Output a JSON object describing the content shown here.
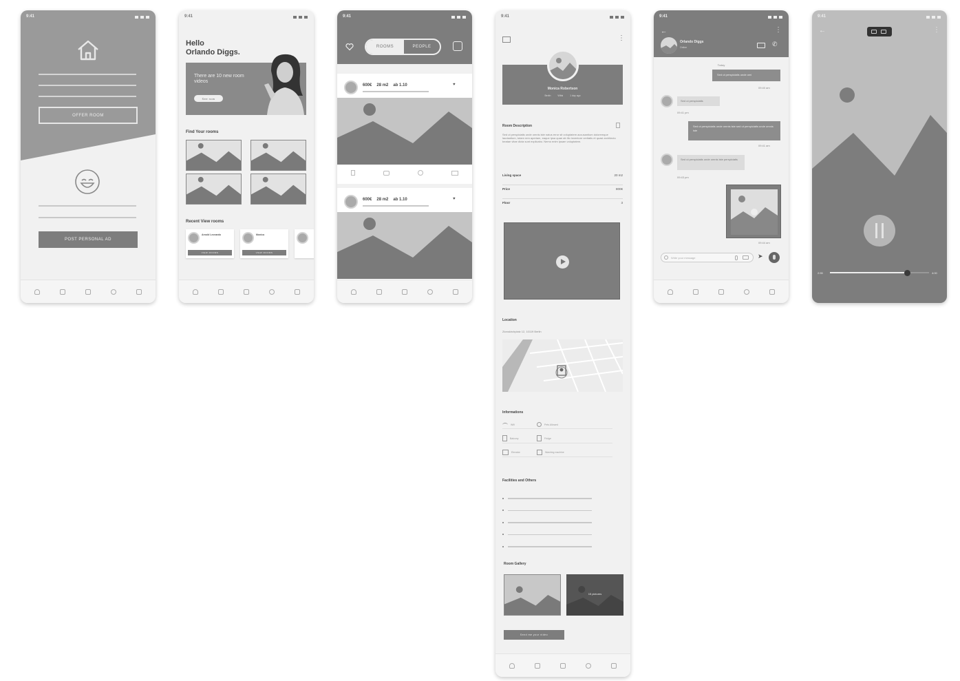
{
  "status_time": "9:41",
  "screen1": {
    "offer_room": "OFFER ROOM",
    "post_ad": "POST PERSONAL AD"
  },
  "screen2": {
    "greeting": "Hello",
    "user_name": "Orlando Diggs.",
    "banner_text": "There are 10 new room videos",
    "banner_button": "See now",
    "find_rooms": "Find Your rooms",
    "recent_rooms": "Recent View rooms",
    "recent": [
      {
        "name": "Arnold Leonardo",
        "button": "VIEW ROOMS"
      },
      {
        "name": "Monica",
        "button": "VIEW ROOMS"
      }
    ]
  },
  "screen3": {
    "tab_rooms": "ROOMS",
    "tab_people": "PEOPLE",
    "listings": [
      {
        "price": "600€",
        "size": "28 m2",
        "from": "ab 1.10"
      },
      {
        "price": "600€",
        "size": "28 m2",
        "from": "ab 1.10"
      }
    ]
  },
  "screen4": {
    "profile_name": "Monica Robertson",
    "profile_meta": [
      "Berlin",
      "Wifai",
      "1 day ago"
    ],
    "desc_title": "Room Description",
    "desc_text": "Sed ut perspiciatis unde omnis iste natus error sit voluptatem accusantium doloremque laudantium, totam rem aperiam, eaque ipsa quae ab illo inventore veritatis et quasi architecto beatae vitae dicta sunt explicabo. Nemo enim ipsam voluptatem.",
    "facts": [
      {
        "label": "Living space",
        "value": "20 m2"
      },
      {
        "label": "Price",
        "value": "800€"
      },
      {
        "label": "Floor",
        "value": "3"
      }
    ],
    "location_title": "Location",
    "location_address": "Zionskirchplatz 12, 10119 Berlin",
    "info_title": "Informations",
    "info": [
      {
        "icon": "wifi-icon",
        "label": "Wifi"
      },
      {
        "icon": "paw-icon",
        "label": "Pets Allowed"
      },
      {
        "icon": "balcony-icon",
        "label": "Balcony"
      },
      {
        "icon": "fridge-icon",
        "label": "Fridge"
      },
      {
        "icon": "elevator-icon",
        "label": "Elevator"
      },
      {
        "icon": "washing-machine-icon",
        "label": "Washing machine"
      }
    ],
    "facilities_title": "Facilities and Others",
    "gallery_title": "Room Gallery",
    "gallery_more": "15 pictures",
    "send_video": "Send me your video"
  },
  "screen5": {
    "contact_name": "Orlando Diggs",
    "contact_status": "Online",
    "day_label": "Today",
    "messages": [
      {
        "side": "out",
        "text": "Sed ut perspiciatis unde omi",
        "time": "09:40 am"
      },
      {
        "side": "in",
        "text": "Sed ut perspiciatis",
        "time": "09:41 pm"
      },
      {
        "side": "out",
        "text": "Sed ut perspiciatis unde omnis iste sed ut perspiciatis unde omnis iste",
        "time": "09:41 am"
      },
      {
        "side": "in",
        "text": "Sed ut perspiciatis unde omnis iste perspiciatis",
        "time": "09:43 pm"
      }
    ],
    "image_time": "09:44 am",
    "input_placeholder": "Write your message"
  },
  "screen6": {
    "time_elapsed": "2:55",
    "time_total": "4:00",
    "progress": 0.78
  }
}
